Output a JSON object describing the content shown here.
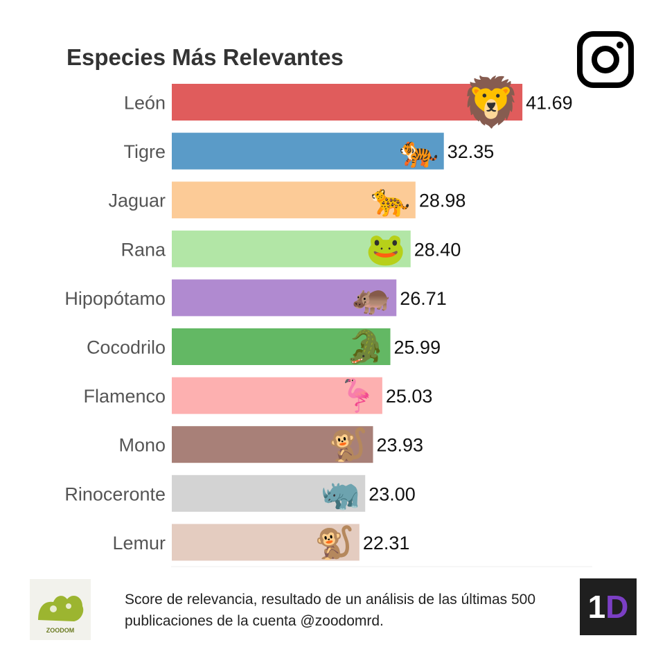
{
  "header": {
    "title": "Especies Más Relevantes"
  },
  "icons": {
    "social": "instagram-icon"
  },
  "chart_data": {
    "type": "bar",
    "orientation": "horizontal",
    "title": "Especies Más Relevantes",
    "categories": [
      "León",
      "Tigre",
      "Jaguar",
      "Rana",
      "Hipopótamo",
      "Cocodrilo",
      "Flamenco",
      "Mono",
      "Rinoceronte",
      "Lemur"
    ],
    "values": [
      41.69,
      32.35,
      28.98,
      28.4,
      26.71,
      25.99,
      25.03,
      23.93,
      23.0,
      22.31
    ],
    "value_labels": [
      "41.69",
      "32.35",
      "28.98",
      "28.40",
      "26.71",
      "25.99",
      "25.03",
      "23.93",
      "23.00",
      "22.31"
    ],
    "colors": [
      "#e05c5c",
      "#5a9bc8",
      "#fccb97",
      "#b2e6a6",
      "#b08ad0",
      "#63b864",
      "#fdb0b0",
      "#a88078",
      "#d3d3d3",
      "#e4ccc0"
    ],
    "icons": [
      "lion-icon",
      "tiger-icon",
      "jaguar-icon",
      "frog-icon",
      "hippo-icon",
      "crocodile-icon",
      "flamingo-icon",
      "monkey-icon",
      "rhino-icon",
      "lemur-icon"
    ],
    "emoji": [
      "🦁",
      "🐅",
      "🐆",
      "🐸",
      "🦛",
      "🐊",
      "🦩",
      "🐒",
      "🦏",
      "🐒"
    ],
    "xlim": [
      0,
      50
    ],
    "xlabel": "",
    "ylabel": "",
    "grid": false,
    "legend": "none"
  },
  "footer": {
    "note_line1": "Score de relevancia, resultado de un análisis de las últimas 500",
    "note_line2": "publicaciones de la cuenta @zoodomrd.",
    "zoo_logo_text": "ZOODOM",
    "brand_one": "1",
    "brand_d": "D"
  }
}
